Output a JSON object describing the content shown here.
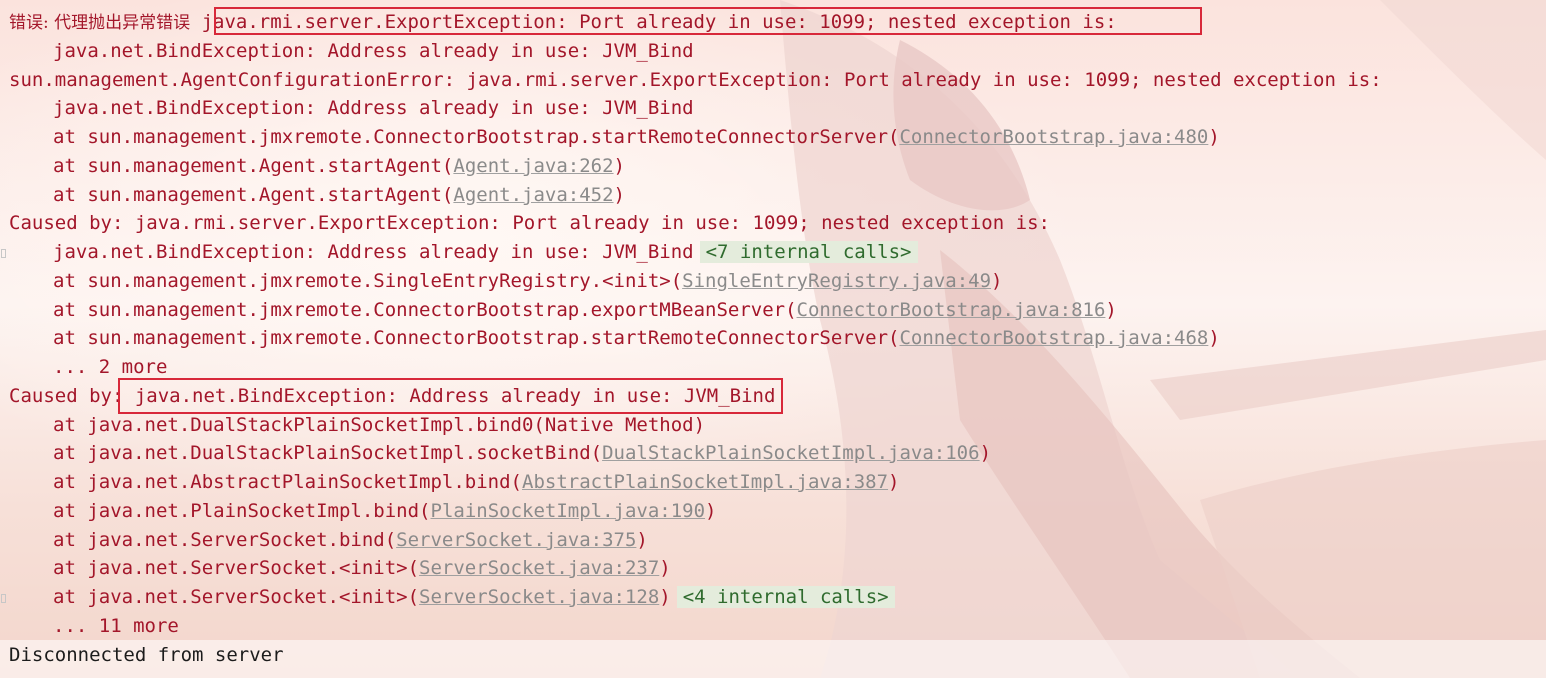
{
  "console": {
    "lines": [
      {
        "parts": [
          "错误: 代理抛出异常错误",
          " java.rmi.server.ExportException: Port already in use: 1099; nested exception is:"
        ]
      },
      {
        "text": "java.net.BindException: Address already in use: JVM_Bind"
      },
      {
        "text": "sun.management.AgentConfigurationError: java.rmi.server.ExportException: Port already in use: 1099; nested exception is:"
      },
      {
        "text": "java.net.BindException: Address already in use: JVM_Bind"
      },
      {
        "prefix": "at sun.management.jmxremote.ConnectorBootstrap.startRemoteConnectorServer(",
        "link": "ConnectorBootstrap.java:480",
        "suffix": ")"
      },
      {
        "prefix": "at sun.management.Agent.startAgent(",
        "link": "Agent.java:262",
        "suffix": ")"
      },
      {
        "prefix": "at sun.management.Agent.startAgent(",
        "link": "Agent.java:452",
        "suffix": ")"
      },
      {
        "text": "Caused by: java.rmi.server.ExportException: Port already in use: 1099; nested exception is:"
      },
      {
        "text": "java.net.BindException: Address already in use: JVM_Bind",
        "internal": "<7 internal calls>"
      },
      {
        "prefix": "at sun.management.jmxremote.SingleEntryRegistry.<init>(",
        "link": "SingleEntryRegistry.java:49",
        "suffix": ")"
      },
      {
        "prefix": "at sun.management.jmxremote.ConnectorBootstrap.exportMBeanServer(",
        "link": "ConnectorBootstrap.java:816",
        "suffix": ")"
      },
      {
        "prefix": "at sun.management.jmxremote.ConnectorBootstrap.startRemoteConnectorServer(",
        "link": "ConnectorBootstrap.java:468",
        "suffix": ")"
      },
      {
        "text": "... 2 more"
      },
      {
        "parts": [
          "Caused by: ",
          "java.net.BindException: Address already in use: JVM_Bind"
        ]
      },
      {
        "text": "at java.net.DualStackPlainSocketImpl.bind0(Native Method)"
      },
      {
        "prefix": "at java.net.DualStackPlainSocketImpl.socketBind(",
        "link": "DualStackPlainSocketImpl.java:106",
        "suffix": ")"
      },
      {
        "prefix": "at java.net.AbstractPlainSocketImpl.bind(",
        "link": "AbstractPlainSocketImpl.java:387",
        "suffix": ")"
      },
      {
        "prefix": "at java.net.PlainSocketImpl.bind(",
        "link": "PlainSocketImpl.java:190",
        "suffix": ")"
      },
      {
        "prefix": "at java.net.ServerSocket.bind(",
        "link": "ServerSocket.java:375",
        "suffix": ")"
      },
      {
        "prefix": "at java.net.ServerSocket.<init>(",
        "link": "ServerSocket.java:237",
        "suffix": ")"
      },
      {
        "prefix": "at java.net.ServerSocket.<init>(",
        "link": "ServerSocket.java:128",
        "suffix": ")",
        "internal": "<4 internal calls>"
      },
      {
        "text": "... 11 more"
      },
      {
        "text": "Disconnected from server"
      }
    ]
  },
  "colors": {
    "error_text": "#a3162a",
    "link_text": "#8a8a8a",
    "internal_calls_bg": "#e4ecdc",
    "internal_calls_text": "#2f6b2e",
    "highlight_box": "#d8283a",
    "plain_text": "#1c1c1c"
  },
  "icons": [
    "fold-marker-icon"
  ]
}
